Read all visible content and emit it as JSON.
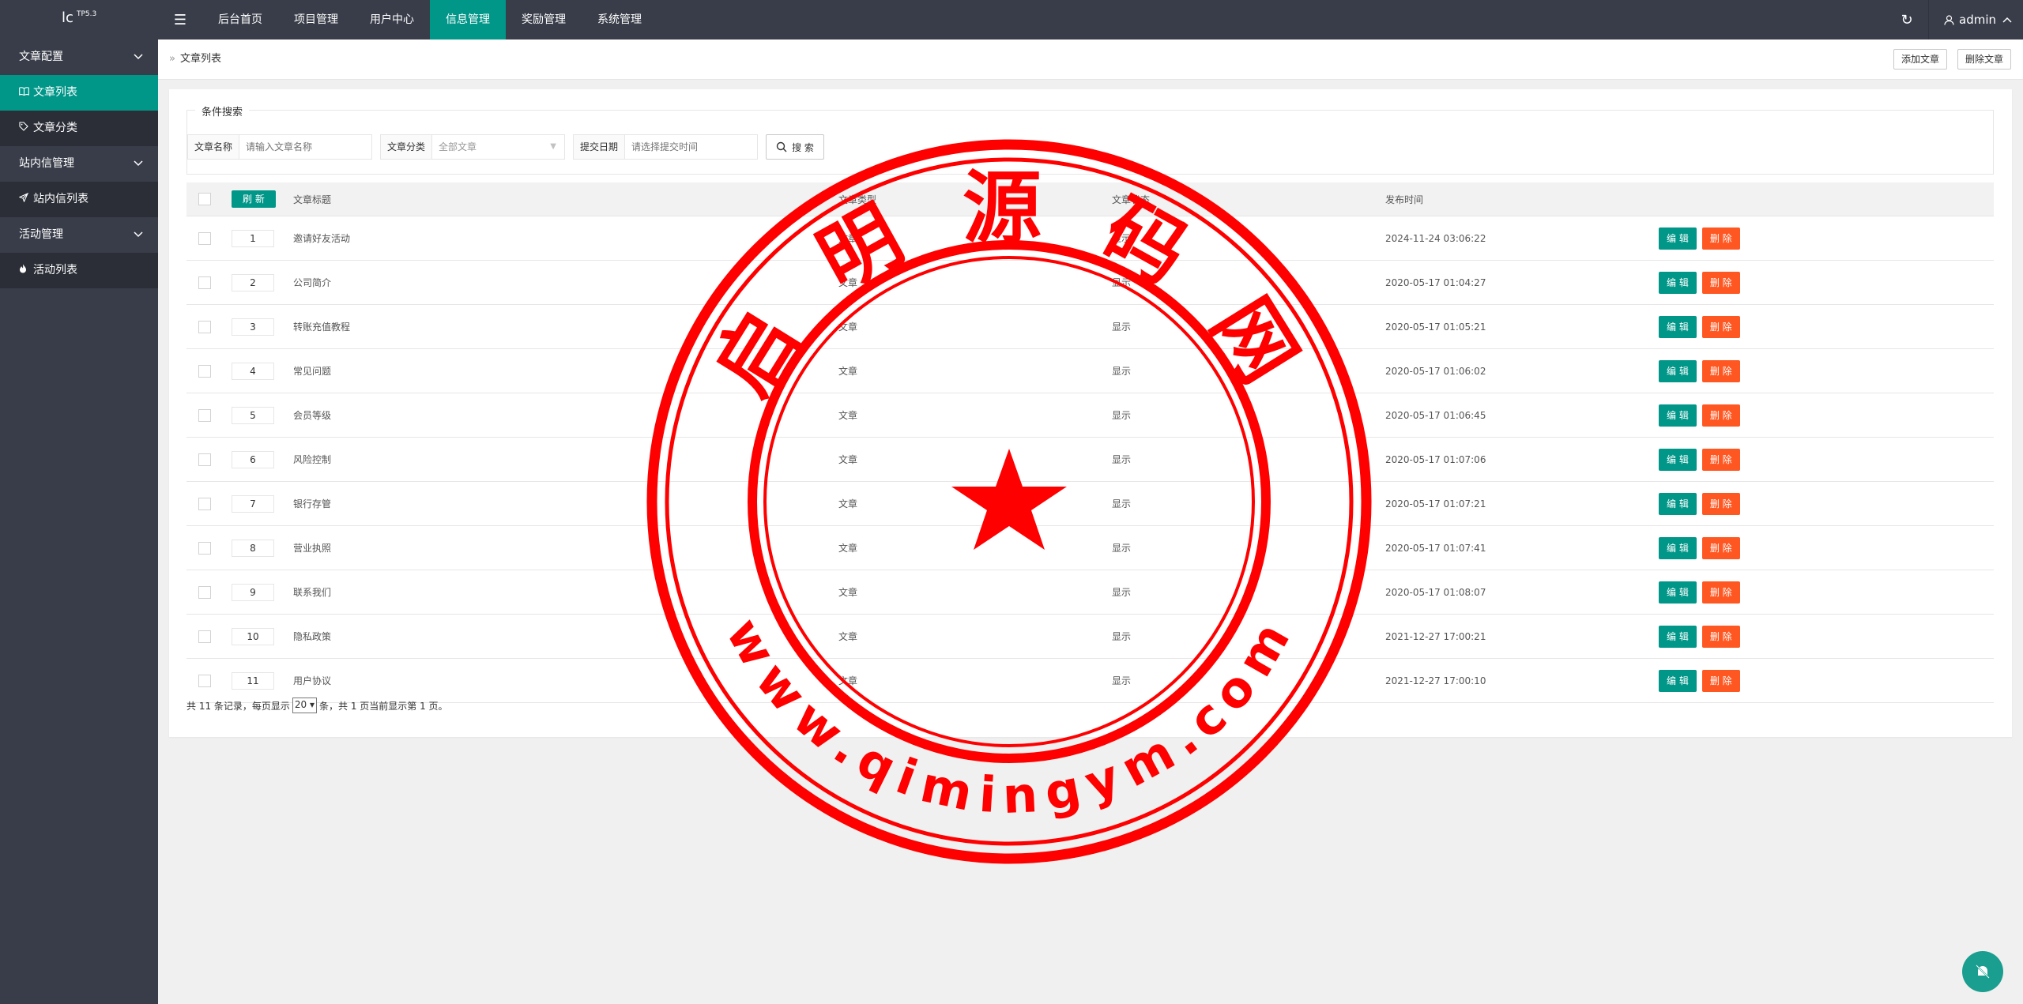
{
  "logo": {
    "text": "lc",
    "version": "TP5.3"
  },
  "header": {
    "menu_icon": "menu-icon",
    "nav": [
      {
        "label": "后台首页",
        "active": false
      },
      {
        "label": "项目管理",
        "active": false
      },
      {
        "label": "用户中心",
        "active": false
      },
      {
        "label": "信息管理",
        "active": true
      },
      {
        "label": "奖励管理",
        "active": false
      },
      {
        "label": "系统管理",
        "active": false
      }
    ],
    "refresh_icon": "refresh-icon",
    "user": "admin"
  },
  "sidebar": {
    "groups": [
      {
        "label": "文章配置",
        "items": [
          {
            "label": "文章列表",
            "icon": "book-icon",
            "active": true
          },
          {
            "label": "文章分类",
            "icon": "tag-icon",
            "active": false
          }
        ]
      },
      {
        "label": "站内信管理",
        "items": [
          {
            "label": "站内信列表",
            "icon": "paper-plane-icon",
            "active": false
          }
        ]
      },
      {
        "label": "活动管理",
        "items": [
          {
            "label": "活动列表",
            "icon": "fire-icon",
            "active": false
          }
        ]
      }
    ]
  },
  "breadcrumb": {
    "current": "文章列表"
  },
  "actions": {
    "add": "添加文章",
    "delete": "删除文章"
  },
  "search": {
    "legend": "条件搜索",
    "name_label": "文章名称",
    "name_placeholder": "请输入文章名称",
    "category_label": "文章分类",
    "category_value": "全部文章",
    "date_label": "提交日期",
    "date_placeholder": "请选择提交时间",
    "button": "搜 索"
  },
  "table": {
    "refresh_button": "刷 新",
    "headers": {
      "title": "文章标题",
      "category": "文章类型",
      "status": "文章状态",
      "time": "发布时间"
    },
    "edit_label": "编 辑",
    "delete_label": "删 除",
    "rows": [
      {
        "sort": "1",
        "title": "邀请好友活动",
        "category": "文章",
        "status": "显示",
        "time": "2024-11-24 03:06:22"
      },
      {
        "sort": "2",
        "title": "公司简介",
        "category": "文章",
        "status": "显示",
        "time": "2020-05-17 01:04:27"
      },
      {
        "sort": "3",
        "title": "转账充值教程",
        "category": "文章",
        "status": "显示",
        "time": "2020-05-17 01:05:21"
      },
      {
        "sort": "4",
        "title": "常见问题",
        "category": "文章",
        "status": "显示",
        "time": "2020-05-17 01:06:02"
      },
      {
        "sort": "5",
        "title": "会员等级",
        "category": "文章",
        "status": "显示",
        "time": "2020-05-17 01:06:45"
      },
      {
        "sort": "6",
        "title": "风险控制",
        "category": "文章",
        "status": "显示",
        "time": "2020-05-17 01:07:06"
      },
      {
        "sort": "7",
        "title": "银行存管",
        "category": "文章",
        "status": "显示",
        "time": "2020-05-17 01:07:21"
      },
      {
        "sort": "8",
        "title": "营业执照",
        "category": "文章",
        "status": "显示",
        "time": "2020-05-17 01:07:41"
      },
      {
        "sort": "9",
        "title": "联系我们",
        "category": "文章",
        "status": "显示",
        "time": "2020-05-17 01:08:07"
      },
      {
        "sort": "10",
        "title": "隐私政策",
        "category": "文章",
        "status": "显示",
        "time": "2021-12-27 17:00:21"
      },
      {
        "sort": "11",
        "title": "用户协议",
        "category": "文章",
        "status": "显示",
        "time": "2021-12-27 17:00:10"
      }
    ]
  },
  "pagination": {
    "prefix": "共 11 条记录，每页显示",
    "page_size": "20",
    "suffix": "条，共 1 页当前显示第 1 页。"
  },
  "watermark": {
    "top_text": "启 明 源 码 网",
    "bottom_text": "www.qimingym.com"
  },
  "colors": {
    "header_bg": "#393d49",
    "accent": "#009688",
    "danger": "#FF5722",
    "status_green": "#5FB878",
    "stamp_red": "#ff0000"
  }
}
